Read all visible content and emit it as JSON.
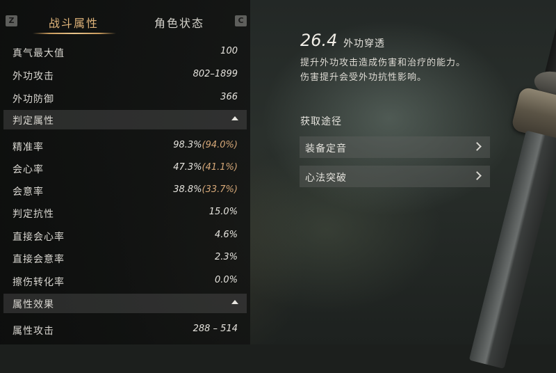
{
  "tabs": {
    "left_key": "Z",
    "right_key": "C",
    "items": [
      {
        "label": "战斗属性",
        "active": true
      },
      {
        "label": "角色状态",
        "active": false
      }
    ]
  },
  "stats_top": [
    {
      "label": "真气最大值",
      "value": "100"
    },
    {
      "label": "外功攻击",
      "value": "802–1899"
    },
    {
      "label": "外功防御",
      "value": "366"
    }
  ],
  "section_judgement": {
    "title": "判定属性",
    "rows": [
      {
        "label": "精准率",
        "value": "98.3%",
        "paren_open": "(",
        "paren_value": "94.0%",
        "paren_close": ")"
      },
      {
        "label": "会心率",
        "value": "47.3%",
        "paren_open": "(",
        "paren_value": "41.1%",
        "paren_close": ")"
      },
      {
        "label": "会意率",
        "value": "38.8%",
        "paren_open": "(",
        "paren_value": "33.7%",
        "paren_close": ")"
      },
      {
        "label": "判定抗性",
        "value": "15.0%"
      },
      {
        "label": "直接会心率",
        "value": "4.6%"
      },
      {
        "label": "直接会意率",
        "value": "2.3%"
      },
      {
        "label": "擦伤转化率",
        "value": "0.0%"
      }
    ]
  },
  "section_attribute": {
    "title": "属性效果",
    "rows": [
      {
        "label": "属性攻击",
        "value": "288 – 514"
      }
    ]
  },
  "detail": {
    "value": "26.4",
    "name": "外功穿透",
    "desc_line1": "提升外功攻击造成伤害和治疗的能力。",
    "desc_line2": "伤害提升会受外功抗性影响。",
    "acquire_title": "获取途径",
    "acquire_items": [
      {
        "label": "装备定音"
      },
      {
        "label": "心法突破"
      }
    ]
  },
  "colors": {
    "accent_gold": "#e0b47a",
    "paren_orange": "#d6a878"
  },
  "icons": [
    "chevron-up-icon",
    "chevron-right-icon",
    "sword-icon"
  ]
}
